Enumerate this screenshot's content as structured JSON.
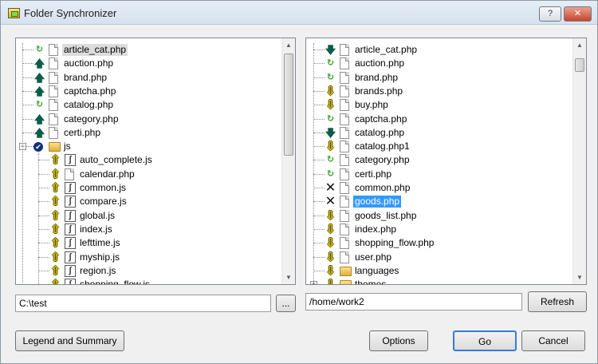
{
  "window": {
    "title": "Folder Synchronizer",
    "help_label": "?",
    "close_label": "✕"
  },
  "left": {
    "path": "C:\\test",
    "browse_label": "...",
    "items": [
      {
        "label": "article_cat.php",
        "status": "sync",
        "icon": "file",
        "indent": 0,
        "highlight": true
      },
      {
        "label": "auction.php",
        "status": "up",
        "icon": "file",
        "indent": 0
      },
      {
        "label": "brand.php",
        "status": "up",
        "icon": "file",
        "indent": 0
      },
      {
        "label": "captcha.php",
        "status": "up",
        "icon": "file",
        "indent": 0
      },
      {
        "label": "catalog.php",
        "status": "sync",
        "icon": "file",
        "indent": 0
      },
      {
        "label": "category.php",
        "status": "up",
        "icon": "file",
        "indent": 0
      },
      {
        "label": "certi.php",
        "status": "up",
        "icon": "file",
        "indent": 0
      },
      {
        "label": "js",
        "status": "check",
        "icon": "folder",
        "indent": 0,
        "expander": "−"
      },
      {
        "label": "auto_complete.js",
        "status": "yup",
        "icon": "js",
        "indent": 1
      },
      {
        "label": "calendar.php",
        "status": "yup",
        "icon": "file",
        "indent": 1
      },
      {
        "label": "common.js",
        "status": "yup",
        "icon": "js",
        "indent": 1
      },
      {
        "label": "compare.js",
        "status": "yup",
        "icon": "js",
        "indent": 1
      },
      {
        "label": "global.js",
        "status": "yup",
        "icon": "js",
        "indent": 1
      },
      {
        "label": "index.js",
        "status": "yup",
        "icon": "js",
        "indent": 1
      },
      {
        "label": "lefttime.js",
        "status": "yup",
        "icon": "js",
        "indent": 1
      },
      {
        "label": "myship.js",
        "status": "yup",
        "icon": "js",
        "indent": 1
      },
      {
        "label": "region.js",
        "status": "yup",
        "icon": "js",
        "indent": 1
      },
      {
        "label": "shopping_flow.js",
        "status": "yup",
        "icon": "js",
        "indent": 1
      }
    ]
  },
  "right": {
    "path": "/home/work2",
    "refresh_label": "Refresh",
    "items": [
      {
        "label": "article_cat.php",
        "status": "down",
        "icon": "file"
      },
      {
        "label": "auction.php",
        "status": "sync",
        "icon": "file"
      },
      {
        "label": "brand.php",
        "status": "sync",
        "icon": "file"
      },
      {
        "label": "brands.php",
        "status": "ydown",
        "icon": "file"
      },
      {
        "label": "buy.php",
        "status": "ydown",
        "icon": "file"
      },
      {
        "label": "captcha.php",
        "status": "sync",
        "icon": "file"
      },
      {
        "label": "catalog.php",
        "status": "down",
        "icon": "file"
      },
      {
        "label": "catalog.php1",
        "status": "ydown",
        "icon": "file"
      },
      {
        "label": "category.php",
        "status": "sync",
        "icon": "file"
      },
      {
        "label": "certi.php",
        "status": "sync",
        "icon": "file"
      },
      {
        "label": "common.php",
        "status": "x",
        "icon": "file"
      },
      {
        "label": "goods.php",
        "status": "x",
        "icon": "file",
        "selected": true
      },
      {
        "label": "goods_list.php",
        "status": "ydown",
        "icon": "file"
      },
      {
        "label": "index.php",
        "status": "ydown",
        "icon": "file"
      },
      {
        "label": "shopping_flow.php",
        "status": "ydown",
        "icon": "file"
      },
      {
        "label": "user.php",
        "status": "ydown",
        "icon": "file"
      },
      {
        "label": "languages",
        "status": "ydown",
        "icon": "folder"
      },
      {
        "label": "themes",
        "status": "ydown",
        "icon": "folder",
        "expander": "+"
      }
    ]
  },
  "buttons": {
    "legend": "Legend and Summary",
    "options": "Options",
    "go": "Go",
    "cancel": "Cancel"
  },
  "status_icons": {
    "up": "🡅",
    "down": "🡇",
    "sync": "↻",
    "check": "✔",
    "yup": "⇧",
    "ydown": "⇩",
    "x": "✕"
  }
}
